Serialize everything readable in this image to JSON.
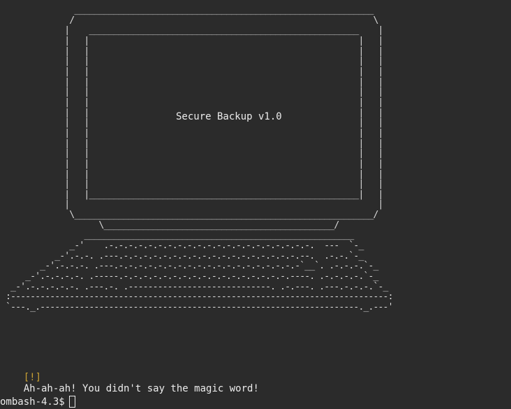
{
  "screen": {
    "title": "Secure Backup v1.0"
  },
  "ascii_art": "                _____________________________________________________________\n               /                                                             \\\n              |    _______________________________________________________    |\n              |   |                                                       |   |\n              |   |                                                       |   |\n              |   |                                                       |   |\n              |   |                                                       |   |\n              |   |                                                       |   |\n              |   |                                                       |   |\n              |   |                                                       |   |\n              |   |                                                       |   |\n              |   |                                                       |   |\n              |   |                                                       |   |\n              |   |                                                       |   |\n              |   |                                                       |   |\n              |   |                                                       |   |\n              |   |                                                       |   |\n              |   |                                                       |   |\n              |   |_______________________________________________________|   |\n              |                                                               |\n               \\_____________________________________________________________/\n                     \\_______________________________________________/\n                  _______________________________________________________\n               _-'    .-.-.-.-.-.-.-.-.-.-.-.-.-.-.-.-.-.-.-.-.-.  ---  `-_\n            _-'.-.-. .---.-.-.-.-.-.-.-.-.-.-.-.-.-.-.-.-.-.-.--.  .-.-.`-_\n         _-'.-.-.-. .---.-.-.-.-.-.-.-.-.-.-.-.-.-.-.-.-.-.-.-`__`. .-.-.-.`-_\n      _-'.-.-.-.-. .-----.-.-.-.-.-.-.-.-.-.-.-.-.-.-.-.-.-.----. .-.-.-.-.`-_\n   _-'.-.-.-.-.-. .---.-. .-----------------------------. .-.---. .---.-.-.-.`-_\n  :-----------------------------------------------------------------------------:\n  `---._.-----------------------------------------------------------------._.---'",
  "terminal": {
    "warning_tag": "[!]",
    "warning_message": "Ah-ah-ah! You didn't say the magic word!",
    "prompt": "ombash-4.3$"
  },
  "colors": {
    "background": "#2b2b2b",
    "foreground": "#ececec",
    "warning": "#c8a033"
  }
}
